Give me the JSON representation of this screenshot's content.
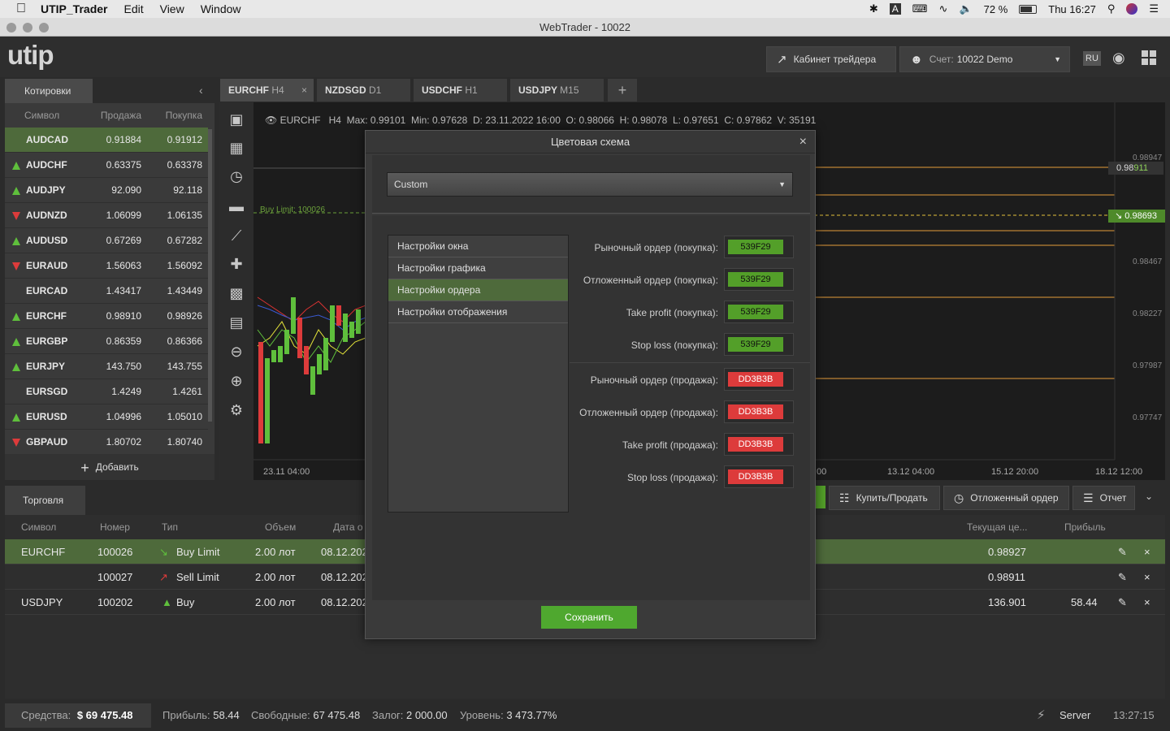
{
  "menubar": {
    "apple": "",
    "app": "UTIP_Trader",
    "items": [
      "Edit",
      "View",
      "Window"
    ],
    "battery": "72 %",
    "clock": "Thu 16:27"
  },
  "window": {
    "title": "WebTrader - 10022"
  },
  "header": {
    "logo": "utip",
    "cabinet_btn": "Кабинет трейдера",
    "account_label": "Счет:",
    "account_value": "10022 Demo",
    "lang": "RU"
  },
  "quotes": {
    "tab": "Котировки",
    "columns": [
      "Символ",
      "Продажа",
      "Покупка"
    ],
    "rows": [
      {
        "symbol": "AUDCAD",
        "bid": "0.91884",
        "ask": "0.91912",
        "dir": "none"
      },
      {
        "symbol": "AUDCHF",
        "bid": "0.63375",
        "ask": "0.63378",
        "dir": "up"
      },
      {
        "symbol": "AUDJPY",
        "bid": "92.090",
        "ask": "92.118",
        "dir": "up"
      },
      {
        "symbol": "AUDNZD",
        "bid": "1.06099",
        "ask": "1.06135",
        "dir": "down"
      },
      {
        "symbol": "AUDUSD",
        "bid": "0.67269",
        "ask": "0.67282",
        "dir": "up"
      },
      {
        "symbol": "EURAUD",
        "bid": "1.56063",
        "ask": "1.56092",
        "dir": "down"
      },
      {
        "symbol": "EURCAD",
        "bid": "1.43417",
        "ask": "1.43449",
        "dir": "none"
      },
      {
        "symbol": "EURCHF",
        "bid": "0.98910",
        "ask": "0.98926",
        "dir": "up"
      },
      {
        "symbol": "EURGBP",
        "bid": "0.86359",
        "ask": "0.86366",
        "dir": "up"
      },
      {
        "symbol": "EURJPY",
        "bid": "143.750",
        "ask": "143.755",
        "dir": "up"
      },
      {
        "symbol": "EURSGD",
        "bid": "1.4249",
        "ask": "1.4261",
        "dir": "none"
      },
      {
        "symbol": "EURUSD",
        "bid": "1.04996",
        "ask": "1.05010",
        "dir": "up"
      },
      {
        "symbol": "GBPAUD",
        "bid": "1.80702",
        "ask": "1.80740",
        "dir": "down"
      }
    ],
    "add_label": "Добавить"
  },
  "chart_tabs": [
    {
      "symbol": "EURCHF",
      "tf": "H4"
    },
    {
      "symbol": "NZDSGD",
      "tf": "D1"
    },
    {
      "symbol": "USDCHF",
      "tf": "H1"
    },
    {
      "symbol": "USDJPY",
      "tf": "M15"
    }
  ],
  "chart": {
    "info": "EURCHF   H4  Max: 0.99101  Min: 0.97628  D: 23.11.2022 16:00  O: 0.98066  H: 0.98078  L: 0.97651  C: 0.97862  V: 35191",
    "buy_limit_label": "Buy Limit: 100026",
    "price_ticks": [
      "0.98947",
      "0.98467",
      "0.98227",
      "0.97987",
      "0.97747"
    ],
    "price_tag_1a": "0.98",
    "price_tag_1b": "911",
    "price_tag_2": "0.98693",
    "time_ticks": [
      "23.11 04:00",
      ":00",
      "13.12 04:00",
      "15.12 20:00",
      "18.12 12:00"
    ]
  },
  "actions": {
    "buy_sell": "Купить/Продать",
    "pending": "Отложенный ордер",
    "report": "Отчет"
  },
  "trading": {
    "tab": "Торговля",
    "columns": [
      "Символ",
      "Номер",
      "Тип",
      "Объем",
      "Дата о",
      "Текущая це...",
      "Прибыль"
    ],
    "rows": [
      {
        "symbol": "EURCHF",
        "number": "100026",
        "type": "Buy Limit",
        "volume": "2.00 лот",
        "date": "08.12.202",
        "price": "0.98927",
        "profit": ""
      },
      {
        "symbol": "",
        "number": "100027",
        "type": "Sell Limit",
        "volume": "2.00 лот",
        "date": "08.12.202",
        "price": "0.98911",
        "profit": ""
      },
      {
        "symbol": "USDJPY",
        "number": "100202",
        "type": "Buy",
        "volume": "2.00 лот",
        "date": "08.12.202",
        "price": "136.901",
        "profit": "58.44"
      }
    ]
  },
  "status": {
    "funds_label": "Средства:",
    "funds_value": "$ 69 475.48",
    "profit_label": "Прибыль:",
    "profit_value": "58.44",
    "free_label": "Свободные:",
    "free_value": "67 475.48",
    "margin_label": "Залог:",
    "margin_value": "2 000.00",
    "level_label": "Уровень:",
    "level_value": "3 473.77%",
    "server": "Server",
    "time": "13:27:15"
  },
  "dialog": {
    "title": "Цветовая схема",
    "scheme": "Custom",
    "menu": [
      "Настройки окна",
      "Настройки графика",
      "Настройки ордера",
      "Настройки отображения"
    ],
    "buy_rows": [
      {
        "label": "Рыночный ордер (покупка):",
        "value": "539F29"
      },
      {
        "label": "Отложенный ордер (покупка):",
        "value": "539F29"
      },
      {
        "label": "Take profit (покупка):",
        "value": "539F29"
      },
      {
        "label": "Stop loss (покупка):",
        "value": "539F29"
      }
    ],
    "sell_rows": [
      {
        "label": "Рыночный ордер (продажа):",
        "value": "DD3B3B"
      },
      {
        "label": "Отложенный ордер (продажа):",
        "value": "DD3B3B"
      },
      {
        "label": "Take profit (продажа):",
        "value": "DD3B3B"
      },
      {
        "label": "Stop loss (продажа):",
        "value": "DD3B3B"
      }
    ],
    "save": "Сохранить"
  },
  "colors": {
    "green": "#539f29",
    "red": "#dd3b3b",
    "accent": "#4e7a2f"
  }
}
